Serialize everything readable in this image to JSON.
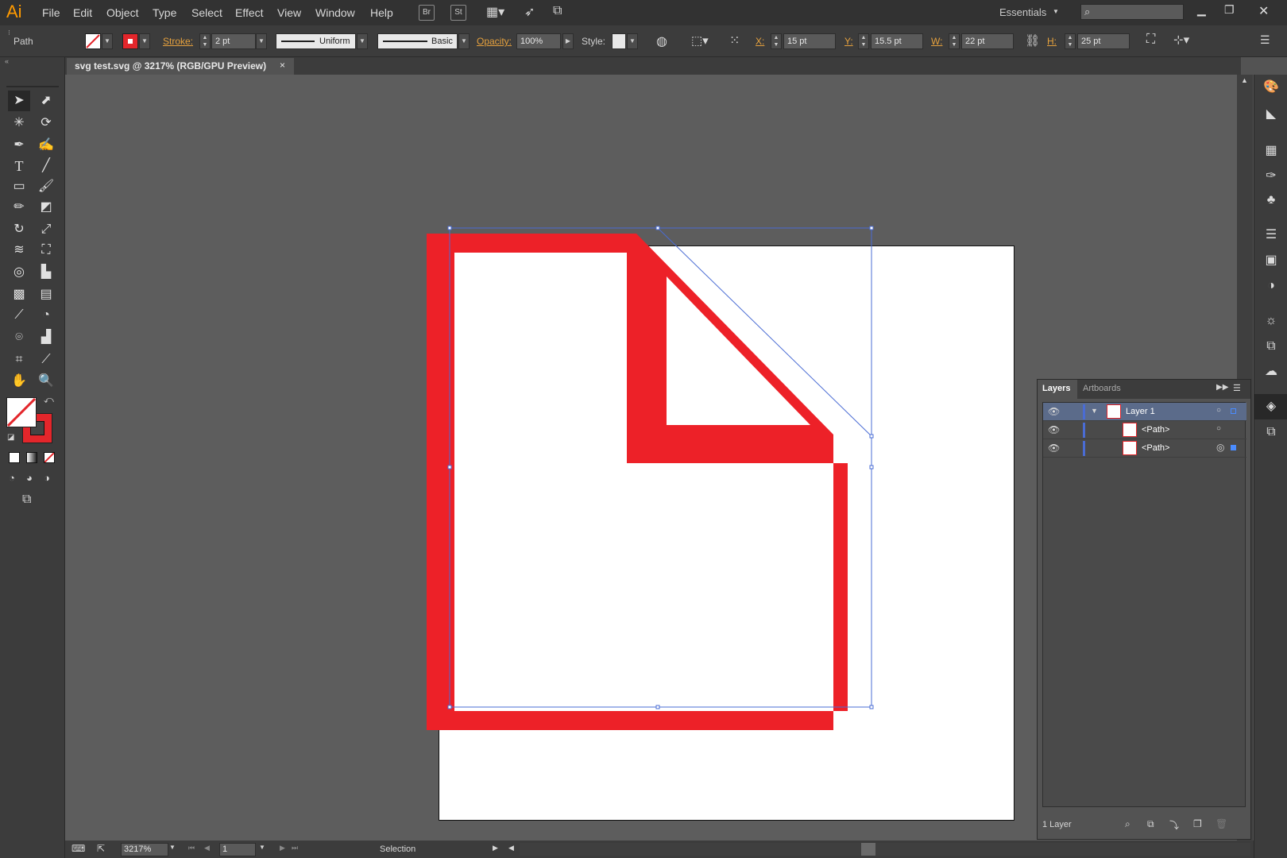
{
  "app": {
    "logo": "Ai",
    "workspace": "Essentials",
    "search_placeholder": ""
  },
  "menu": [
    "File",
    "Edit",
    "Object",
    "Type",
    "Select",
    "Effect",
    "View",
    "Window",
    "Help"
  ],
  "bridge_buttons": [
    "Br",
    "St"
  ],
  "control": {
    "selection_type": "Path",
    "stroke_label": "Stroke:",
    "stroke_value": "2 pt",
    "profile_label": "Uniform",
    "brush_label": "Basic",
    "opacity_label": "Opacity:",
    "opacity_value": "100%",
    "style_label": "Style:",
    "x_label": "X:",
    "x_value": "15 pt",
    "y_label": "Y:",
    "y_value": "15.5 pt",
    "w_label": "W:",
    "w_value": "22 pt",
    "h_label": "H:",
    "h_value": "25 pt"
  },
  "document": {
    "tab_title": "svg test.svg @ 3217% (RGB/GPU Preview)",
    "close": "×"
  },
  "artwork": {
    "stroke_color": "#ed2128",
    "selection_color": "#4a6cd4"
  },
  "colors": {
    "accent": "#e5a13e",
    "fill_none": "#ffffff",
    "stroke_red": "#e3262b"
  },
  "layers_panel": {
    "tabs": [
      "Layers",
      "Artboards"
    ],
    "rows": [
      {
        "label": "Layer 1"
      },
      {
        "label": "<Path>"
      },
      {
        "label": "<Path>"
      }
    ],
    "footer": "1 Layer"
  },
  "status": {
    "zoom": "3217%",
    "page": "1",
    "tool": "Selection"
  }
}
